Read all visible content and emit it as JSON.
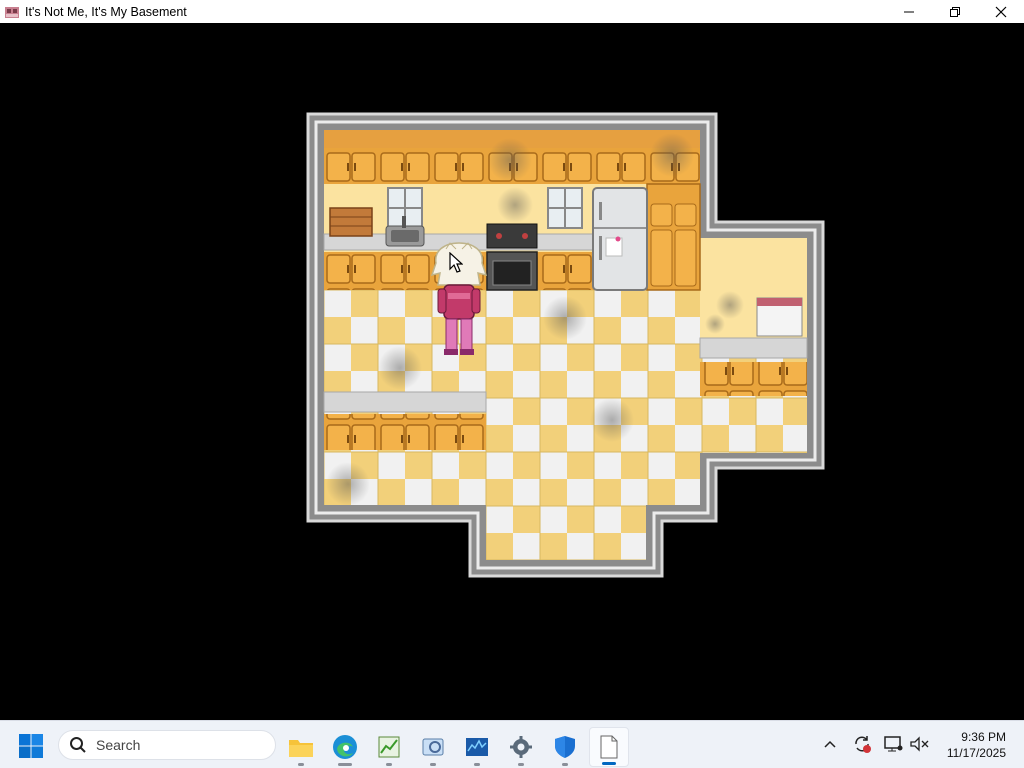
{
  "window": {
    "title": "It's Not Me, It's My Basement",
    "app_icon": "game-window-icon",
    "controls": [
      "minimize-icon",
      "restore-icon",
      "close-icon"
    ]
  },
  "game": {
    "scene": "kitchen-top-down",
    "character": "pink-outfit-white-hair-character",
    "cursor": "arrow-cursor-icon"
  },
  "taskbar": {
    "search_label": "Search",
    "apps": [
      {
        "icon": "file-explorer-icon",
        "running": true,
        "active": false
      },
      {
        "icon": "edge-browser-icon",
        "running": true,
        "active": false
      },
      {
        "icon": "task-manager-chart-icon",
        "running": true,
        "active": false
      },
      {
        "icon": "image-viewer-icon",
        "running": true,
        "active": false
      },
      {
        "icon": "performance-monitor-icon",
        "running": true,
        "active": false
      },
      {
        "icon": "settings-gear-icon",
        "running": true,
        "active": false
      },
      {
        "icon": "windows-security-shield-icon",
        "running": true,
        "active": false
      },
      {
        "icon": "blank-document-icon",
        "running": true,
        "active": true
      }
    ],
    "tray": [
      "chevron-up-icon",
      "sync-alert-icon",
      "display-icon",
      "network-sound-icon"
    ],
    "time": "9:36 PM",
    "date": "11/17/2025"
  }
}
